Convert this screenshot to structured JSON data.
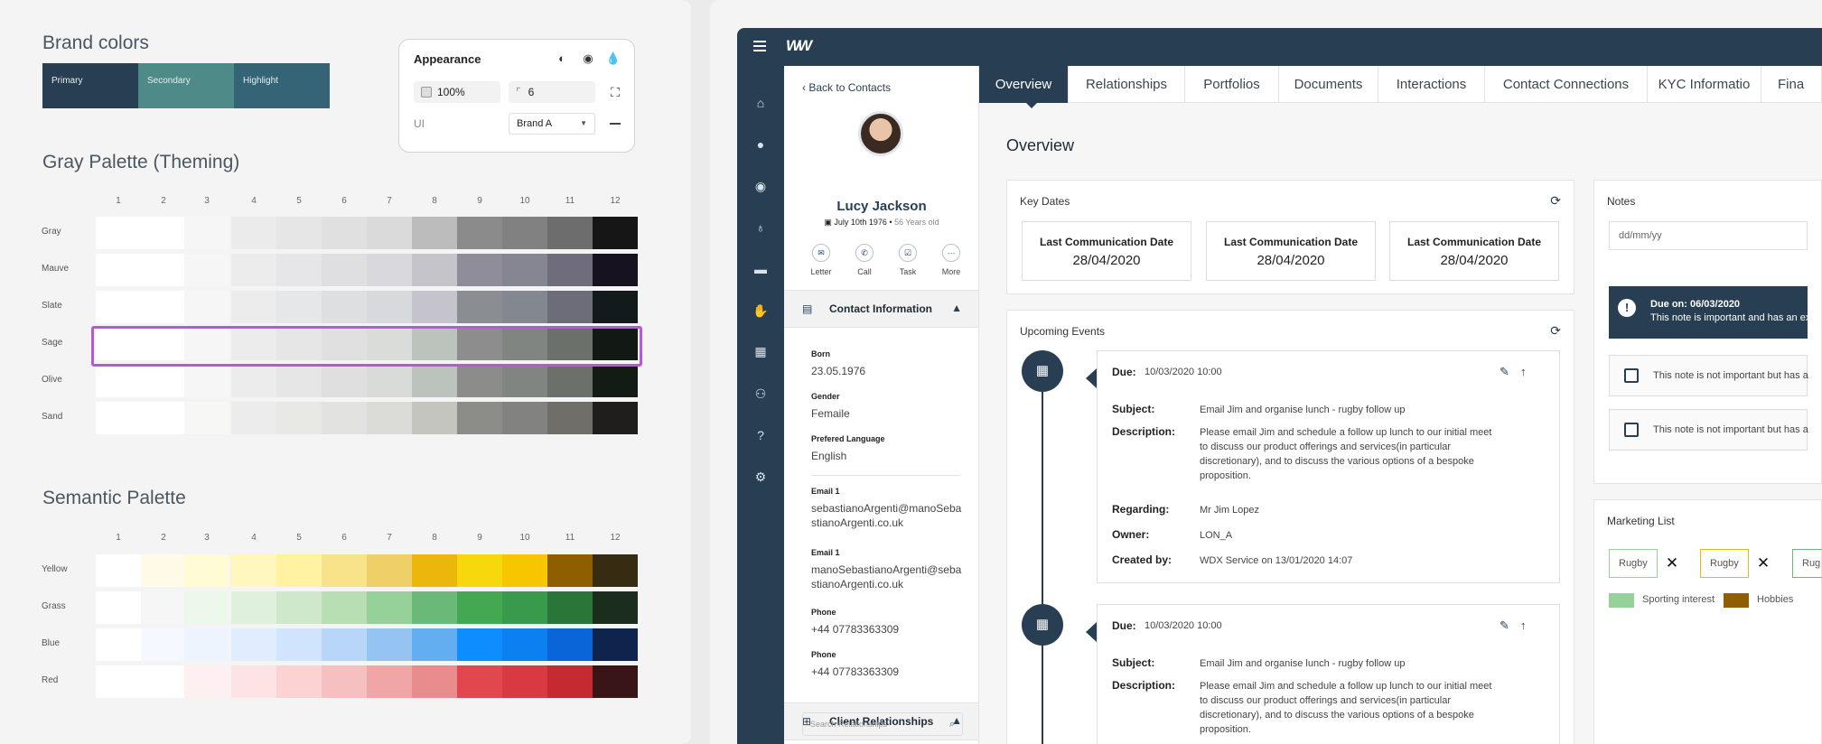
{
  "design_system": {
    "brand_title": "Brand colors",
    "brand": [
      {
        "label": "Primary",
        "color": "#283f53"
      },
      {
        "label": "Secondary",
        "color": "#4e8a88"
      },
      {
        "label": "Highlight",
        "color": "#356476"
      }
    ],
    "appearance": {
      "title": "Appearance",
      "icons": [
        "contrast-icon",
        "eye-icon",
        "drop-icon"
      ],
      "scale_value": "100%",
      "radius_value": "6",
      "ui_label": "UI",
      "theme_value": "Brand A"
    },
    "gray_title": "Gray Palette (Theming)",
    "semantic_title": "Semantic Palette",
    "columns": [
      "1",
      "2",
      "3",
      "4",
      "5",
      "6",
      "7",
      "8",
      "9",
      "10",
      "11",
      "12"
    ],
    "gray_rows": [
      {
        "name": "Gray",
        "colors": [
          "#ffffff",
          "#ffffff",
          "#f7f6f6",
          "#ebebeb",
          "#e6e6e6",
          "#e0e0e0",
          "#dadada",
          "#bcbcbc",
          "#8b8b8b",
          "#818181",
          "#6d6d6d",
          "#161616"
        ]
      },
      {
        "name": "Mauve",
        "colors": [
          "#ffffff",
          "#ffffff",
          "#f7f6f7",
          "#ececed",
          "#e6e5e7",
          "#dfdee1",
          "#d9d8dc",
          "#c5c4cb",
          "#8f8d99",
          "#868592",
          "#6f6d7b",
          "#17121f"
        ]
      },
      {
        "name": "Slate",
        "colors": [
          "#ffffff",
          "#ffffff",
          "#f6f6f7",
          "#ececed",
          "#e6e7e8",
          "#dedfe1",
          "#d8d9dc",
          "#c5c4cc",
          "#8a8d91",
          "#828790",
          "#6c6d78",
          "#121a1c"
        ]
      },
      {
        "name": "Sage",
        "colors": [
          "#ffffff",
          "#ffffff",
          "#f6f6f6",
          "#ececec",
          "#e5e6e5",
          "#dfe0df",
          "#d9dcd9",
          "#bcc2bc",
          "#8c8d8c",
          "#818582",
          "#6b706b",
          "#121814"
        ]
      },
      {
        "name": "Olive",
        "colors": [
          "#ffffff",
          "#ffffff",
          "#f6f6f6",
          "#ececec",
          "#e5e6e5",
          "#dedfde",
          "#d9dbd9",
          "#bcc2bc",
          "#8c8d8b",
          "#818582",
          "#6b706b",
          "#131c14"
        ]
      },
      {
        "name": "Sand",
        "colors": [
          "#ffffff",
          "#ffffff",
          "#f7f7f5",
          "#ececec",
          "#e8e8e4",
          "#e2e2e0",
          "#dbdbd8",
          "#c5c5c0",
          "#8c8c89",
          "#828280",
          "#706e69",
          "#1f1e1d"
        ]
      }
    ],
    "semantic_rows": [
      {
        "name": "Yellow",
        "colors": [
          "#ffffff",
          "#fffbe8",
          "#fffbd4",
          "#fff7bd",
          "#fff2a0",
          "#f8e38a",
          "#efd068",
          "#ecb70c",
          "#f7d80c",
          "#f6c701",
          "#8f5e00",
          "#372c11"
        ]
      },
      {
        "name": "Grass",
        "colors": [
          "#ffffff",
          "#f6f6f6",
          "#ecf8ea",
          "#dff1dd",
          "#cfe8cc",
          "#b8dfb4",
          "#97d19a",
          "#6ab978",
          "#44a853",
          "#3a9a4c",
          "#2a7639",
          "#1b2d1c"
        ]
      },
      {
        "name": "Blue",
        "colors": [
          "#ffffff",
          "#f5f9ff",
          "#edf4fe",
          "#e0edfe",
          "#d0e5fd",
          "#b8d6f8",
          "#95c3f2",
          "#63aef1",
          "#0d8dff",
          "#0b80f0",
          "#0a66d8",
          "#0e244d"
        ]
      },
      {
        "name": "Red",
        "colors": [
          "#ffffff",
          "#ffffff",
          "#fef0f0",
          "#fde3e3",
          "#fbd3d3",
          "#f6c0c0",
          "#f0a5a6",
          "#e98c8d",
          "#e2474f",
          "#d83943",
          "#c52a33",
          "#3a1517"
        ]
      }
    ]
  },
  "app": {
    "logo_text": "W",
    "nav_icons": [
      "home-icon",
      "user-icon",
      "user-circle-icon",
      "lightbulb-icon",
      "briefcase-icon",
      "handshake-icon",
      "building-icon",
      "users-icon",
      "help-icon",
      "settings-icon"
    ],
    "contact": {
      "back": "Back to Contacts",
      "name": "Lucy Jackson",
      "dob": "July 10th 1976",
      "age": "56 Years old",
      "actions": [
        "Letter",
        "Call",
        "Task",
        "More"
      ],
      "info_title": "Contact Information",
      "fields": [
        {
          "label": "Born",
          "value": "23.05.1976"
        },
        {
          "label": "Gender",
          "value": "Femaile"
        },
        {
          "label": "Prefered Language",
          "value": "English"
        },
        {
          "label": "Email 1",
          "value": "sebastianoArgenti@manoSebastianoArgenti.co.uk"
        },
        {
          "label": "Email 1",
          "value": "manoSebastianoArgenti@sebastianoArgenti.co.uk"
        },
        {
          "label": "Phone",
          "value": "+44 07783363309"
        },
        {
          "label": "Phone",
          "value": "+44 07783363309"
        }
      ],
      "relationships_title": "Client Relationships",
      "search_placeholder": "Search Relationships"
    },
    "tabs": [
      "Overview",
      "Relationships",
      "Portfolios",
      "Documents",
      "Interactions",
      "Contact Connections",
      "KYC Informatio",
      "Fina"
    ],
    "overview_title": "Overview",
    "key_dates": {
      "title": "Key Dates",
      "items": [
        {
          "label": "Last Communication Date",
          "value": "28/04/2020"
        },
        {
          "label": "Last Communication Date",
          "value": "28/04/2020"
        },
        {
          "label": "Last Communication Date",
          "value": "28/04/2020"
        }
      ]
    },
    "events": {
      "title": "Upcoming Events",
      "items": [
        {
          "due_label": "Due:",
          "due": "10/03/2020 10:00",
          "subject_label": "Subject:",
          "subject": "Email Jim and organise lunch - rugby follow up",
          "description_label": "Description:",
          "description": "Please email Jim and schedule a follow up lunch to our initial meet to discuss our product offerings and services(in particular discretionary), and to discuss the various options of a bespoke proposition.",
          "regarding_label": "Regarding:",
          "regarding": "Mr Jim Lopez",
          "owner_label": "Owner:",
          "owner": "LON_A",
          "created_label": "Created by:",
          "created": "WDX Service on 13/01/2020 14:07"
        },
        {
          "due_label": "Due:",
          "due": "10/03/2020 10:00",
          "subject_label": "Subject:",
          "subject": "Email Jim and organise lunch - rugby follow up",
          "description_label": "Description:",
          "description": "Please email Jim and schedule a follow up lunch to our initial meet to discuss our product offerings and services(in particular discretionary), and to discuss the various options of a bespoke proposition."
        }
      ]
    },
    "notes": {
      "title": "Notes",
      "date_placeholder": "dd/mm/yy",
      "alert_title": "Due on: 06/03/2020",
      "alert_text": "This note is important and has an ex",
      "items": [
        "This note is not important but has a",
        "This note is not important but has a"
      ]
    },
    "marketing": {
      "title": "Marketing List",
      "tags": [
        {
          "label": "Rugby",
          "color": "#97d19a"
        },
        {
          "label": "Rugby",
          "color": "#ecb70c"
        },
        {
          "label": "Rug",
          "color": "#6ab978"
        }
      ],
      "legend": [
        {
          "label": "Sporting interest",
          "color": "#97d19a"
        },
        {
          "label": "Hobbies",
          "color": "#8f5e00"
        }
      ]
    }
  }
}
